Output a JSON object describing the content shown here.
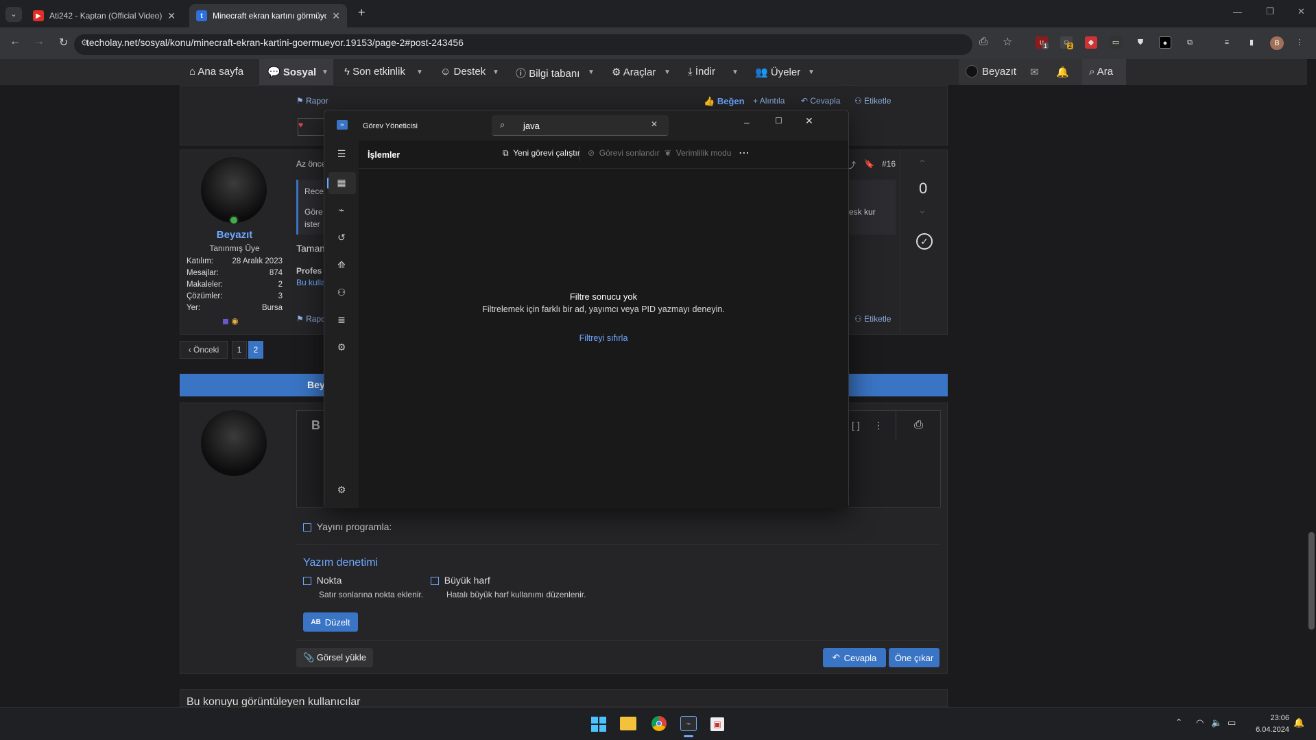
{
  "browser": {
    "tabs": [
      {
        "title": "Ati242 - Kaptan (Official Video)",
        "favicon": "youtube-icon",
        "active": false
      },
      {
        "title": "Minecraft ekran kartını görmüyor",
        "favicon": "techolay-icon",
        "active": true
      }
    ],
    "url": "techolay.net/sosyal/konu/minecraft-ekran-kartini-goermueyor.19153/page-2#post-243456",
    "ext_badges": [
      "1",
      "2"
    ],
    "profile_initial": "B"
  },
  "site_nav": {
    "items": [
      "Ana sayfa",
      "Sosyal",
      "Son etkinlik",
      "Destek",
      "Bilgi tabanı",
      "Araçlar",
      "İndir",
      "Üyeler"
    ],
    "user": "Beyazıt",
    "search": "Ara"
  },
  "post_top": {
    "rapor": "Rapor",
    "begen": "Beğen",
    "alintila": "Alıntıla",
    "cevapla": "Cevapla",
    "etiketle": "Etiketle"
  },
  "post": {
    "time": "Az önce",
    "quote_head": "Rece",
    "quote_body_1": "Göre",
    "quote_body_2": "ister",
    "quote_right": "esk kur",
    "text": "Tamam",
    "sig_1": "Profes",
    "sig_2": "Bu kulla",
    "number": "#16",
    "votes": "0",
    "rapor": "Rapor",
    "etiketle": "Etiketle",
    "author": {
      "name": "Beyazıt",
      "title": "Tanınmış Üye",
      "stats": [
        {
          "k": "Katılım:",
          "v": "28 Aralık 2023"
        },
        {
          "k": "Mesajlar:",
          "v": "874"
        },
        {
          "k": "Makaleler:",
          "v": "2"
        },
        {
          "k": "Çözümler:",
          "v": "3"
        },
        {
          "k": "Yer:",
          "v": "Bursa"
        }
      ]
    }
  },
  "pagination": {
    "prev": "Önceki",
    "pages": [
      "1",
      "2"
    ],
    "current": "2"
  },
  "banner": "Bey",
  "editor": {
    "bold": "B",
    "schedule": "Yayını programla:",
    "spell_title": "Yazım denetimi",
    "opt1_label": "Nokta",
    "opt1_desc": "Satır sonlarına nokta eklenir.",
    "opt2_label": "Büyük harf",
    "opt2_desc": "Hatalı büyük harf kullanımı düzenlenir.",
    "fix_btn": "Düzelt",
    "fix_icon": "AB",
    "upload_btn": "Görsel yükle",
    "reply_btn": "Cevapla",
    "preview_btn": "Öne çıkar"
  },
  "viewers_title": "Bu konuyu görüntüleyen kullanıcılar",
  "task_manager": {
    "title": "Görev Yöneticisi",
    "search_value": "java",
    "section": "İşlemler",
    "cmd_new": "Yeni görevi çalıştır",
    "cmd_end": "Görevi sonlandır",
    "cmd_eff": "Verimlilik modu",
    "empty_title": "Filtre sonucu yok",
    "empty_desc": "Filtrelemek için farklı bir ad, yayımcı veya PID yazmayı deneyin.",
    "reset": "Filtreyi sıfırla"
  },
  "taskbar": {
    "time": "23:06",
    "date": "6.04.2024"
  },
  "colors": {
    "accent": "#3a74c4",
    "link": "#6ea8ff",
    "online": "#3cb043"
  }
}
